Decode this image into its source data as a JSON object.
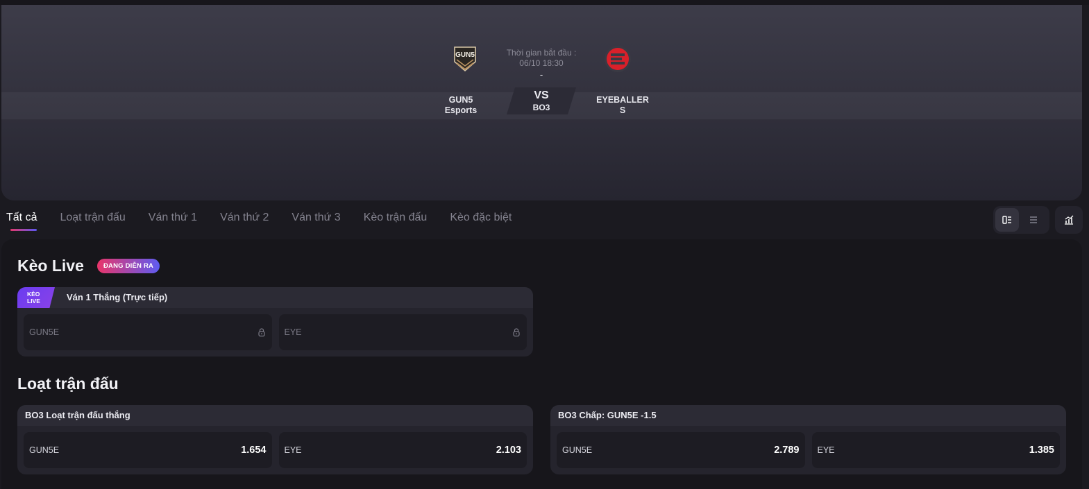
{
  "header": {
    "start_label": "Thời gian bắt đầu :",
    "start_time": "06/10 18:30",
    "start_dash": "-",
    "team1": {
      "name_line1": "GUN5",
      "name_line2": "Esports",
      "logo_text": "GUN5"
    },
    "team2": {
      "name_line1": "EYEBALLER",
      "name_line2": "S"
    },
    "vs": "VS",
    "format": "BO3"
  },
  "tabs": [
    {
      "label": "Tất cả",
      "active": true
    },
    {
      "label": "Loạt trận đấu",
      "active": false
    },
    {
      "label": "Ván thứ 1",
      "active": false
    },
    {
      "label": "Ván thứ 2",
      "active": false
    },
    {
      "label": "Ván thứ 3",
      "active": false
    },
    {
      "label": "Kèo trận đấu",
      "active": false
    },
    {
      "label": "Kèo đặc biệt",
      "active": false
    }
  ],
  "live_section": {
    "title": "Kèo Live",
    "badge": "ĐANG DIỄN RA",
    "market": {
      "tag_line1": "KÈO",
      "tag_line2": "LIVE",
      "title": "Ván 1 Thắng (Trực tiếp)",
      "options": [
        {
          "name": "GUN5E",
          "locked": true,
          "icon": "lock-icon"
        },
        {
          "name": "EYE",
          "locked": true,
          "icon": "lock-icon"
        }
      ]
    }
  },
  "series_section": {
    "title": "Loạt trận đấu",
    "markets": [
      {
        "title": "BO3 Loạt trận đấu thắng",
        "options": [
          {
            "name": "GUN5E",
            "odds": "1.654"
          },
          {
            "name": "EYE",
            "odds": "2.103"
          }
        ]
      },
      {
        "title": "BO3 Chấp: GUN5E -1.5",
        "options": [
          {
            "name": "GUN5E",
            "odds": "2.789"
          },
          {
            "name": "EYE",
            "odds": "1.385"
          }
        ]
      }
    ]
  },
  "colors": {
    "accent_gradient_start": "#e2396c",
    "accent_gradient_end": "#5b56f0",
    "live_tag": "#6a3cf0",
    "team2_logo": "#d9202a",
    "team1_logo_gold": "#b89262"
  },
  "icons": {
    "view_grid": "split-view-icon",
    "view_list": "list-view-icon",
    "stats": "stats-chart-icon"
  }
}
